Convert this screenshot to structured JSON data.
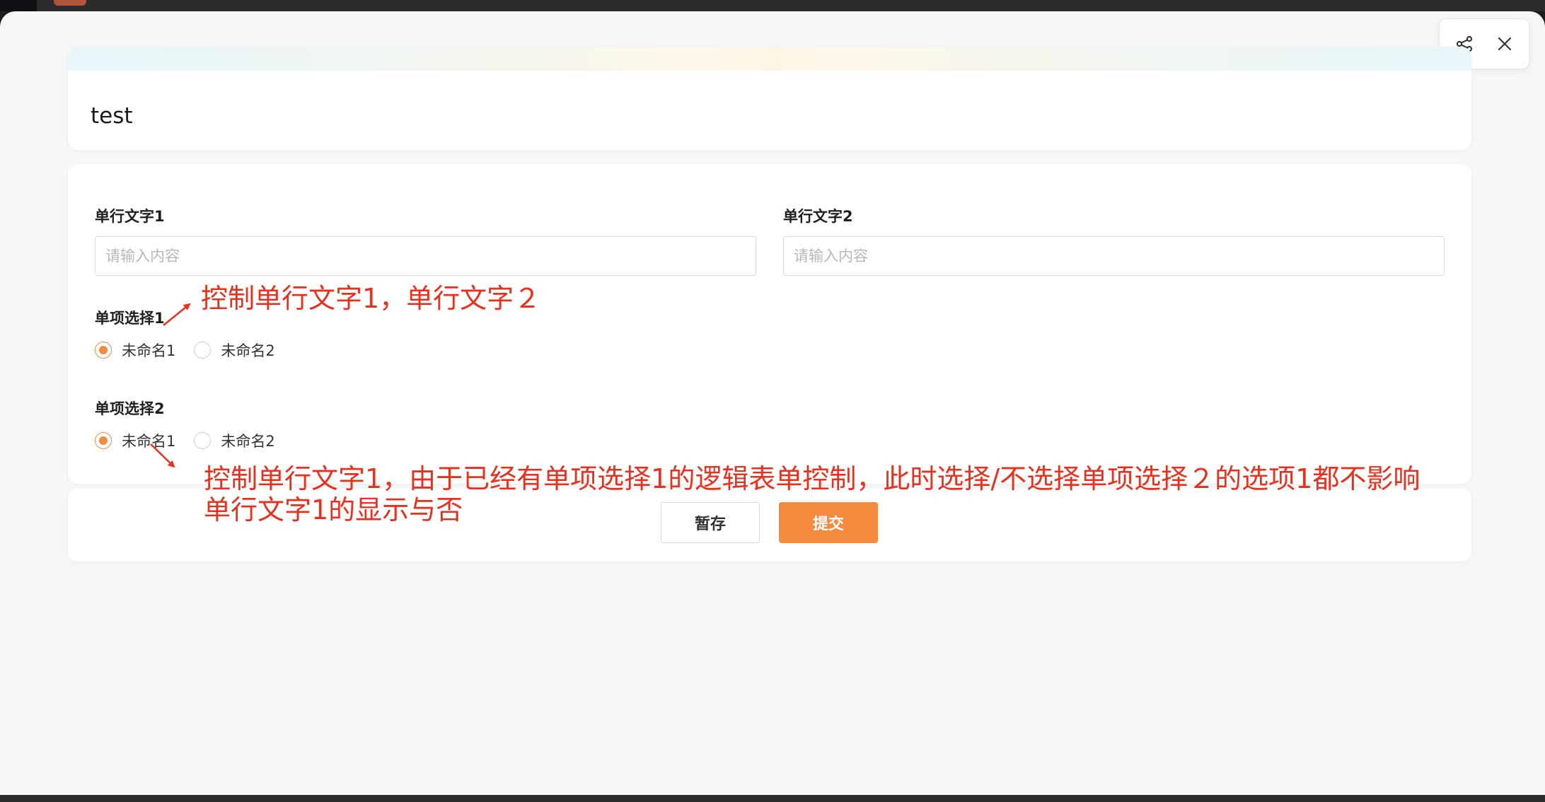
{
  "modal": {
    "title": "test",
    "actions": {
      "share_icon": "share-icon",
      "close_icon": "close-icon"
    }
  },
  "form": {
    "text_field_1": {
      "label": "单行文字1",
      "placeholder": "请输入内容"
    },
    "text_field_2": {
      "label": "单行文字2",
      "placeholder": "请输入内容"
    },
    "radio_1": {
      "label": "单项选择1",
      "options": [
        {
          "label": "未命名1",
          "checked": true
        },
        {
          "label": "未命名2",
          "checked": false
        }
      ]
    },
    "radio_2": {
      "label": "单项选择2",
      "options": [
        {
          "label": "未命名1",
          "checked": true
        },
        {
          "label": "未命名2",
          "checked": false
        }
      ]
    }
  },
  "footer": {
    "draft_label": "暂存",
    "submit_label": "提交"
  },
  "annotations": {
    "note_1": "控制单行文字1，单行文字２",
    "note_2_line1": "控制单行文字1，由于已经有单项选择1的逻辑表单控制，此时选择/不选择单项选择２的选项1都不影响",
    "note_2_line2": "单行文字1的显示与否"
  },
  "colors": {
    "accent": "#f5893d",
    "annotation": "#e8301c"
  }
}
